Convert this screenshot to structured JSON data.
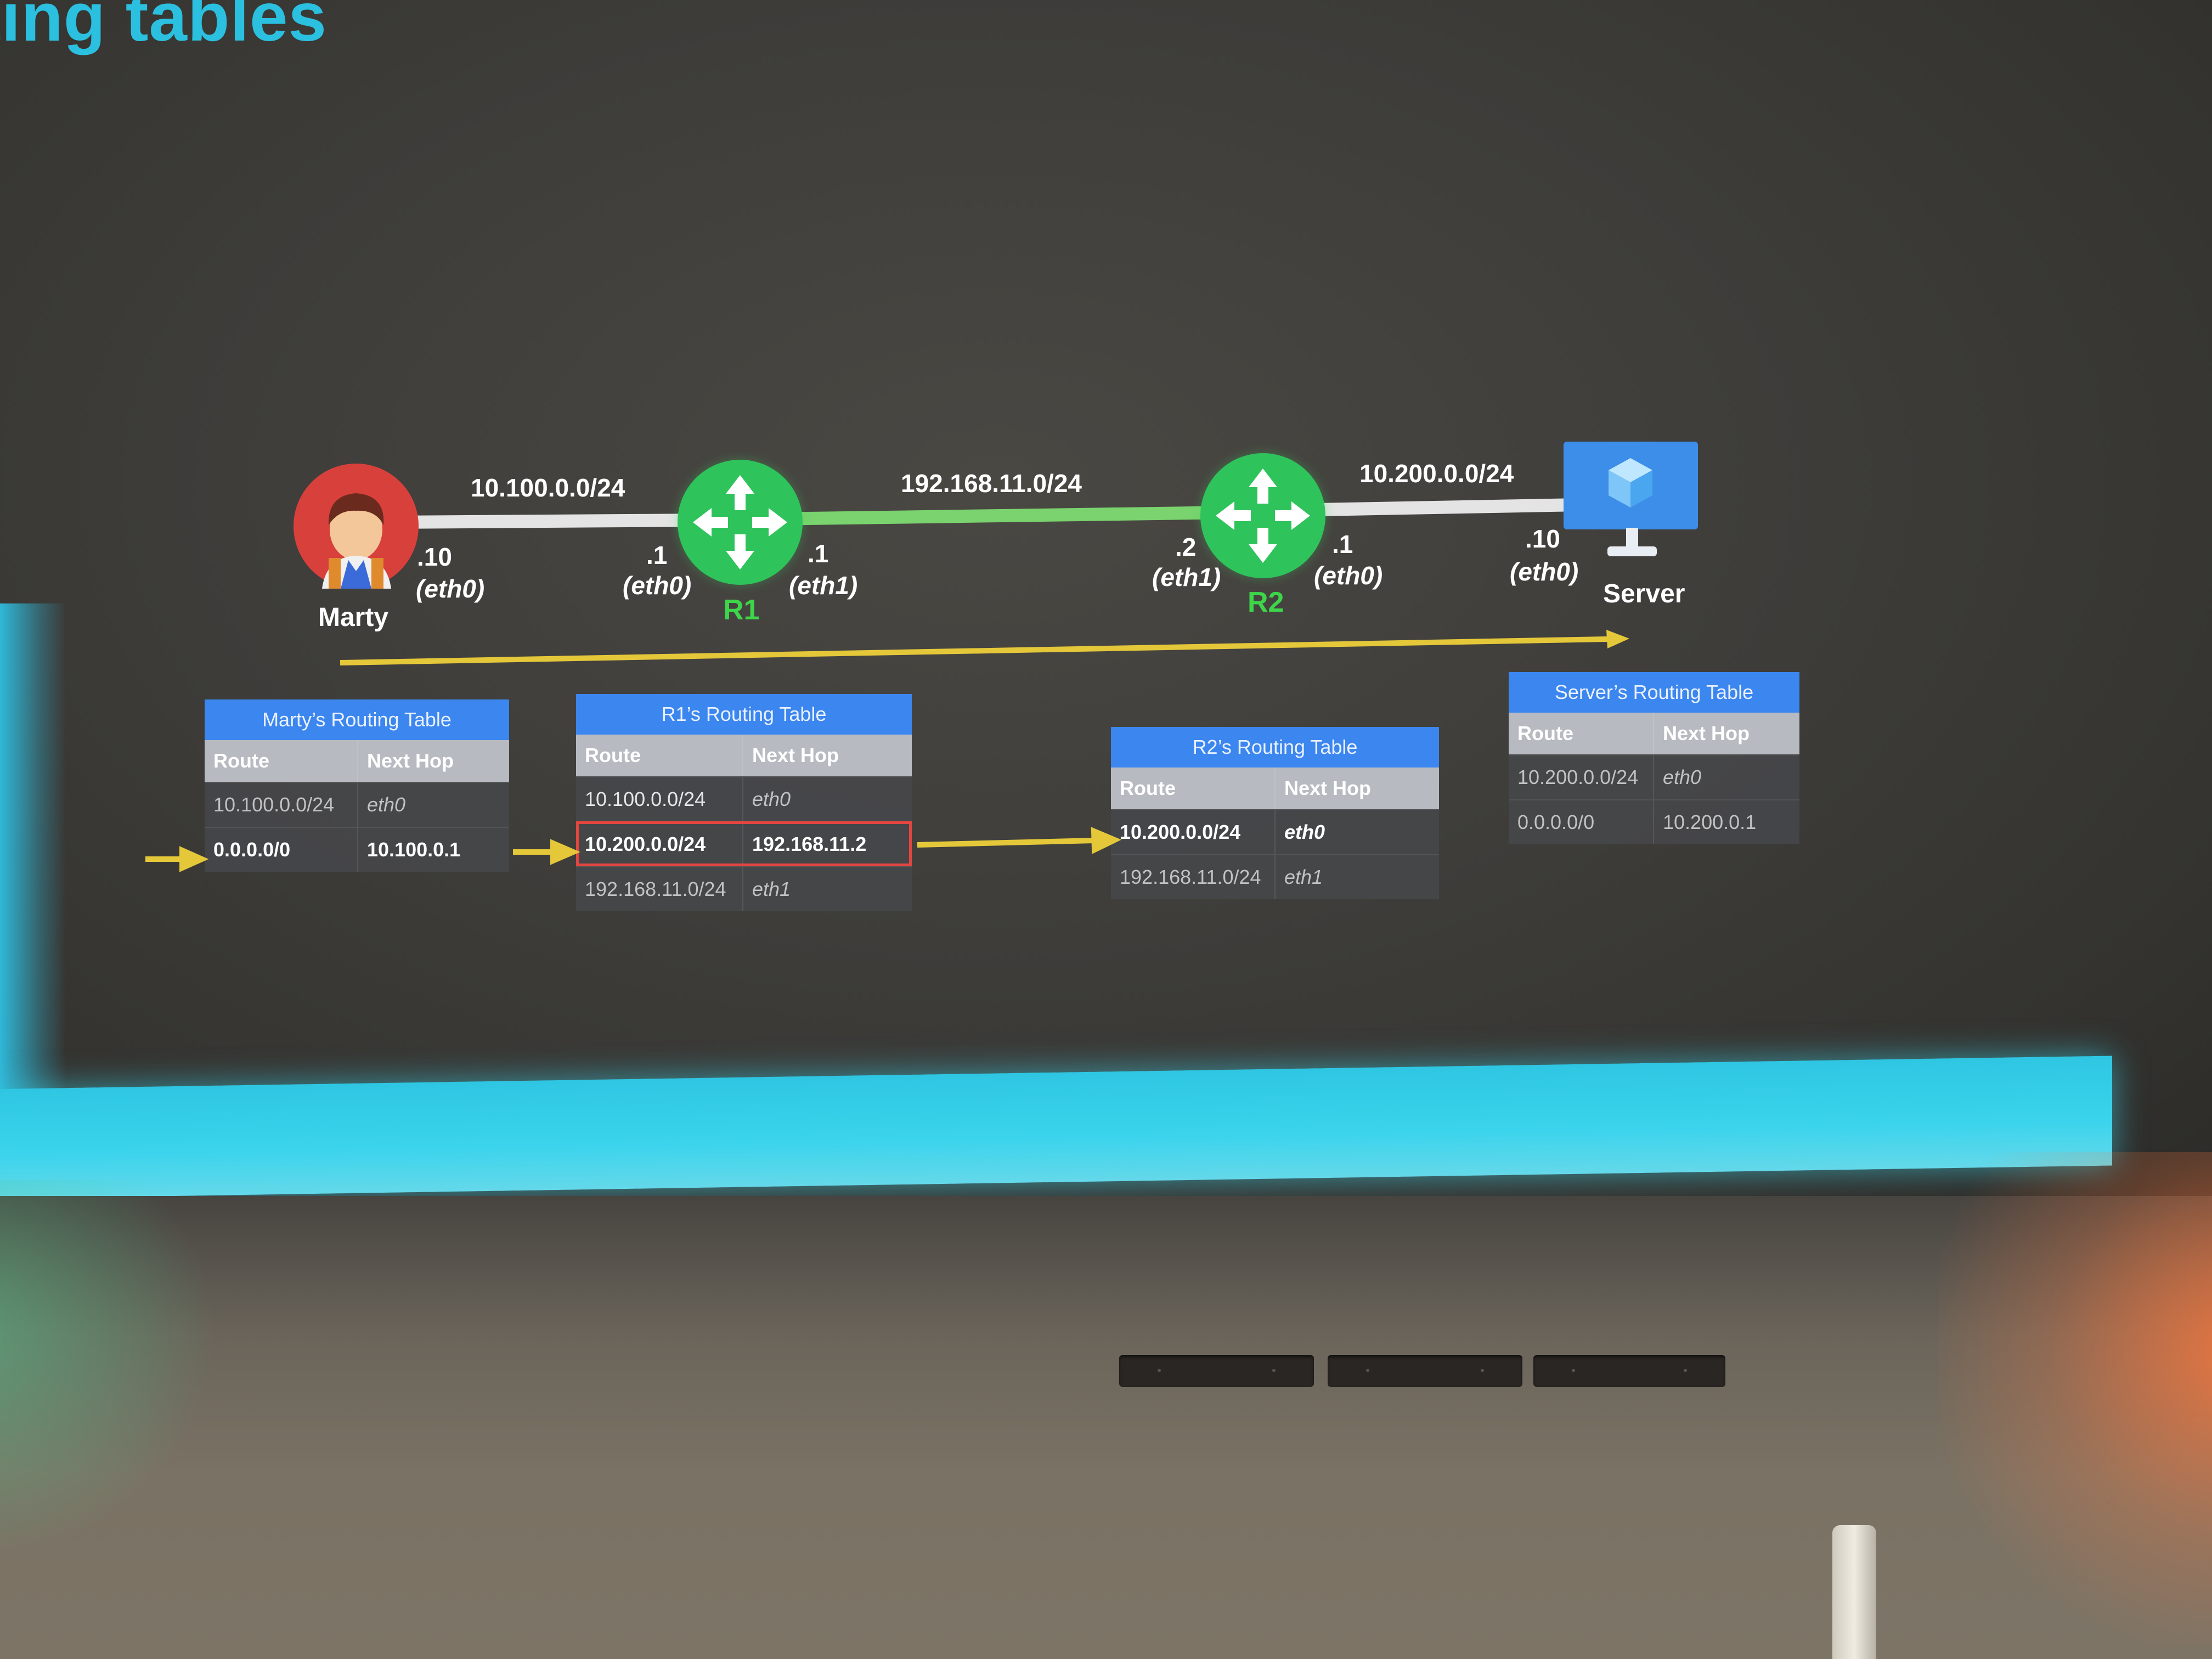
{
  "slide": {
    "title": "ting tables"
  },
  "networks": {
    "left": "10.100.0.0/24",
    "middle": "192.168.11.0/24",
    "right": "10.200.0.0/24"
  },
  "nodes": {
    "marty": {
      "name": "Marty",
      "ip": ".10",
      "iface": "(eth0)"
    },
    "r1": {
      "name": "R1",
      "left_ip": ".1",
      "left_iface": "(eth0)",
      "right_ip": ".1",
      "right_iface": "(eth1)"
    },
    "r2": {
      "name": "R2",
      "left_ip": ".2",
      "left_iface": "(eth1)",
      "right_ip": ".1",
      "right_iface": "(eth0)"
    },
    "server": {
      "name": "Server",
      "ip": ".10",
      "iface": "(eth0)"
    }
  },
  "tables": {
    "marty": {
      "title": "Marty’s Routing Table",
      "headers": [
        "Route",
        "Next Hop"
      ],
      "rows": [
        {
          "route": "10.100.0.0/24",
          "hop": "eth0"
        },
        {
          "route": "0.0.0.0/0",
          "hop": "10.100.0.1"
        }
      ]
    },
    "r1": {
      "title": "R1’s Routing Table",
      "headers": [
        "Route",
        "Next Hop"
      ],
      "rows": [
        {
          "route": "10.100.0.0/24",
          "hop": "eth0"
        },
        {
          "route": "10.200.0.0/24",
          "hop": "192.168.11.2"
        },
        {
          "route": "192.168.11.0/24",
          "hop": "eth1"
        }
      ]
    },
    "r2": {
      "title": "R2’s Routing Table",
      "headers": [
        "Route",
        "Next Hop"
      ],
      "rows": [
        {
          "route": "10.200.0.0/24",
          "hop": "eth0"
        },
        {
          "route": "192.168.11.0/24",
          "hop": "eth1"
        }
      ]
    },
    "server": {
      "title": "Server’s Routing Table",
      "headers": [
        "Route",
        "Next Hop"
      ],
      "rows": [
        {
          "route": "10.200.0.0/24",
          "hop": "eth0"
        },
        {
          "route": "0.0.0.0/0",
          "hop": "10.200.0.1"
        }
      ]
    }
  },
  "colors": {
    "title": "#2bc0e0",
    "router": "#2fc35b",
    "router_label": "#3ed54a",
    "avatar": "#d8403c",
    "server": "#3c8ee8",
    "table_header": "#3c86ef",
    "highlight": "#e2463f",
    "path_arrow": "#e4c83a",
    "accent_bar": "#3bd4ec"
  },
  "icons": [
    "person-avatar-icon",
    "router-icon",
    "server-monitor-icon",
    "cube-icon",
    "arrow-right-icon"
  ]
}
